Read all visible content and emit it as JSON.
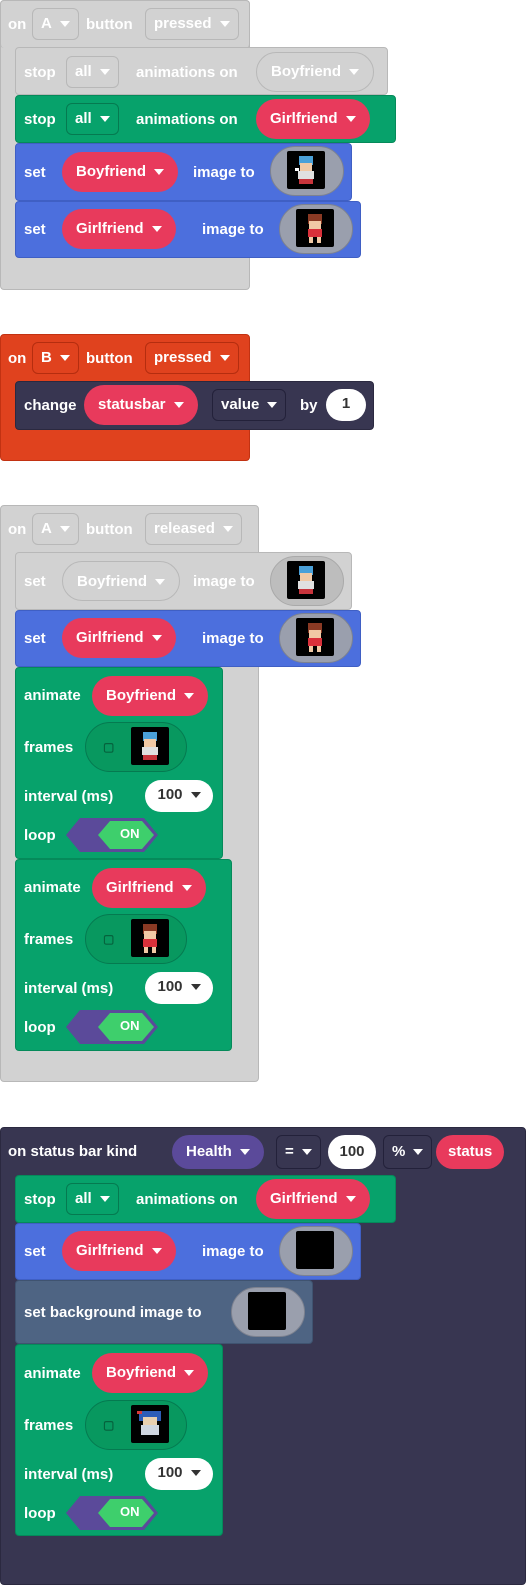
{
  "colors": {
    "event_gray": "#d0d0d0",
    "event_orange": "#e0421e",
    "event_dark": "#383651",
    "green": "#07a26b",
    "blue": "#4c6fdd",
    "red_pill": "#e83a5c",
    "slate": "#4e6483",
    "purple_pill": "#5b4a9a",
    "toggle_on": "#3ecf6c"
  },
  "block1": {
    "on": "on",
    "key": "A",
    "button": "button",
    "state": "pressed",
    "stop1": {
      "stop": "stop",
      "which": "all",
      "animations_on": "animations on",
      "sprite": "Boyfriend"
    },
    "stop2": {
      "stop": "stop",
      "which": "all",
      "animations_on": "animations on",
      "sprite": "Girlfriend"
    },
    "set1": {
      "set": "set",
      "sprite": "Boyfriend",
      "image_to": "image to",
      "image_icon": "boyfriend-sprite-icon"
    },
    "set2": {
      "set": "set",
      "sprite": "Girlfriend",
      "image_to": "image to",
      "image_icon": "girlfriend-sprite-icon"
    }
  },
  "block2": {
    "on": "on",
    "key": "B",
    "button": "button",
    "state": "pressed",
    "change": "change",
    "sprite": "statusbar",
    "property": "value",
    "by": "by",
    "amount": "1"
  },
  "block3": {
    "on": "on",
    "key": "A",
    "button": "button",
    "state": "released",
    "set1": {
      "set": "set",
      "sprite": "Boyfriend",
      "image_to": "image to",
      "image_icon": "boyfriend-sprite-icon"
    },
    "set2": {
      "set": "set",
      "sprite": "Girlfriend",
      "image_to": "image to",
      "image_icon": "girlfriend-sprite-icon"
    },
    "anim1": {
      "animate": "animate",
      "sprite": "Boyfriend",
      "frames": "frames",
      "interval": "interval (ms)",
      "interval_value": "100",
      "loop": "loop",
      "loop_value": "ON",
      "frames_icon": "boyfriend-frames-icon"
    },
    "anim2": {
      "animate": "animate",
      "sprite": "Girlfriend",
      "frames": "frames",
      "interval": "interval (ms)",
      "interval_value": "100",
      "loop": "loop",
      "loop_value": "ON",
      "frames_icon": "girlfriend-frames-icon"
    }
  },
  "block4": {
    "header": "on status bar kind",
    "kind": "Health",
    "operator": "=",
    "threshold": "100",
    "unit": "%",
    "status": "status",
    "stop": {
      "stop": "stop",
      "which": "all",
      "animations_on": "animations on",
      "sprite": "Girlfriend"
    },
    "set": {
      "set": "set",
      "sprite": "Girlfriend",
      "image_to": "image to",
      "image_icon": "black-image-icon"
    },
    "bg": {
      "label": "set background image to",
      "image_icon": "black-image-icon"
    },
    "anim": {
      "animate": "animate",
      "sprite": "Boyfriend",
      "frames": "frames",
      "interval": "interval (ms)",
      "interval_value": "100",
      "loop": "loop",
      "loop_value": "ON",
      "frames_icon": "boyfriend-frames-icon"
    }
  }
}
